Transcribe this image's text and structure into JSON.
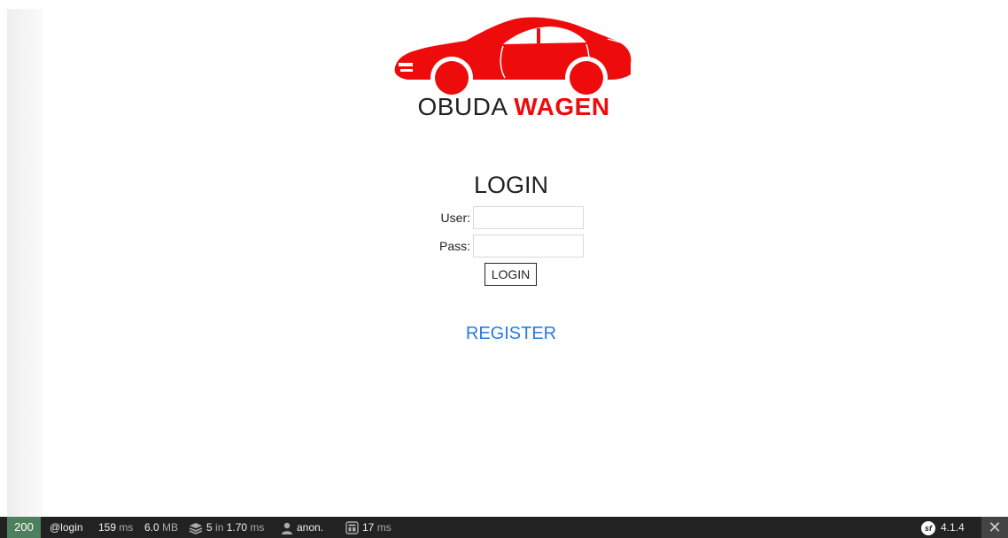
{
  "logo": {
    "text_left": "OBUDA",
    "text_right": "WAGEN",
    "car_color": "#ee0b0b",
    "icon": "car-icon"
  },
  "login": {
    "title": "LOGIN",
    "user_label": "User:",
    "user_value": "",
    "pass_label": "Pass:",
    "pass_value": "",
    "button_label": "LOGIN"
  },
  "register": {
    "label": "REGISTER",
    "color": "#2a7ae2"
  },
  "toolbar": {
    "status_code": "200",
    "status_color": "#4f805d",
    "route": "@login",
    "time_value": "159",
    "time_unit": "ms",
    "memory_value": "6.0",
    "memory_unit": "MB",
    "db_count": "5",
    "db_in": "in",
    "db_time": "1.70",
    "db_unit": "ms",
    "user": "anon.",
    "twig_time": "17",
    "twig_unit": "ms",
    "version": "4.1.4",
    "version_badge": "sf",
    "close_label": "✕"
  }
}
